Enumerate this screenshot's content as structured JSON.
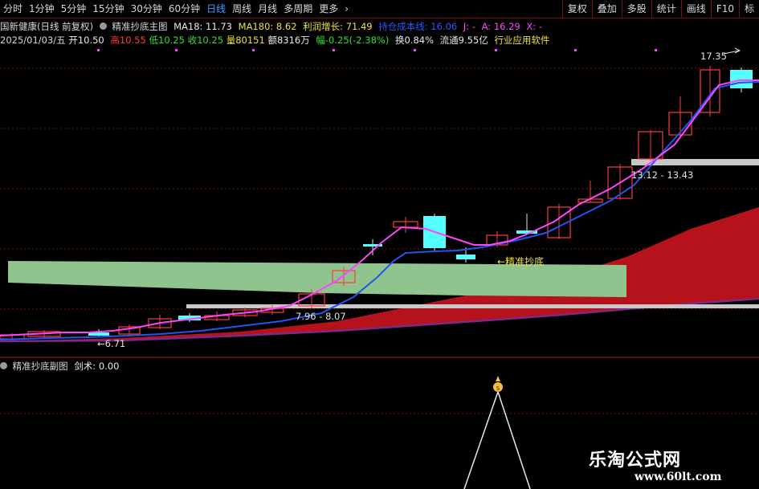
{
  "toolbar": {
    "periods": [
      "分时",
      "1分钟",
      "5分钟",
      "15分钟",
      "30分钟",
      "60分钟",
      "日线",
      "周线",
      "月线",
      "多周期",
      "更多"
    ],
    "active_period": "日线",
    "more_arrow": "›",
    "right_buttons": [
      "复权",
      "叠加",
      "多股",
      "统计",
      "画线",
      "F10",
      "标"
    ]
  },
  "info_line1": {
    "stock": "国新健康(日线 前复权)",
    "indicator_name": "精准抄底主图",
    "ma18": "MA18: 11.73",
    "ma180": "MA180: 8.62",
    "profit": "利润增长: 71.49",
    "cost": "持仓成本线: 16.06",
    "j": "J: -",
    "a": "A: 16.29",
    "x": "X: -"
  },
  "info_line2": {
    "date": "2025/01/03/五",
    "open": "开10.50",
    "high": "高10.55",
    "low": "低10.25",
    "close": "收10.25",
    "volume": "量80151",
    "amount": "额8316万",
    "change": "幅-0.25(-2.38%)",
    "turnover": "换0.84%",
    "float": "流通9.55亿",
    "industry": "行业应用软件"
  },
  "annotations": {
    "high_label": "17.35",
    "low_label": "6.71",
    "range1": "7.96 - 8.07",
    "range2": "13.12 - 13.43",
    "buy_signal": "←精准抄底"
  },
  "sub_panel": {
    "title": "精准抄底副图",
    "value": "剑术: 0.00"
  },
  "watermark": {
    "line1": "乐淘公式网",
    "line2": "www.60lt.com"
  },
  "colors": {
    "up": "#ff3c3c",
    "down": "#54ffff",
    "ma_magenta": "#ff44ff",
    "cost_blue": "#2255ee",
    "green_band": "#8fc48f",
    "red_cloud": "#b5121b",
    "sub_line": "#e8e8e8"
  }
}
